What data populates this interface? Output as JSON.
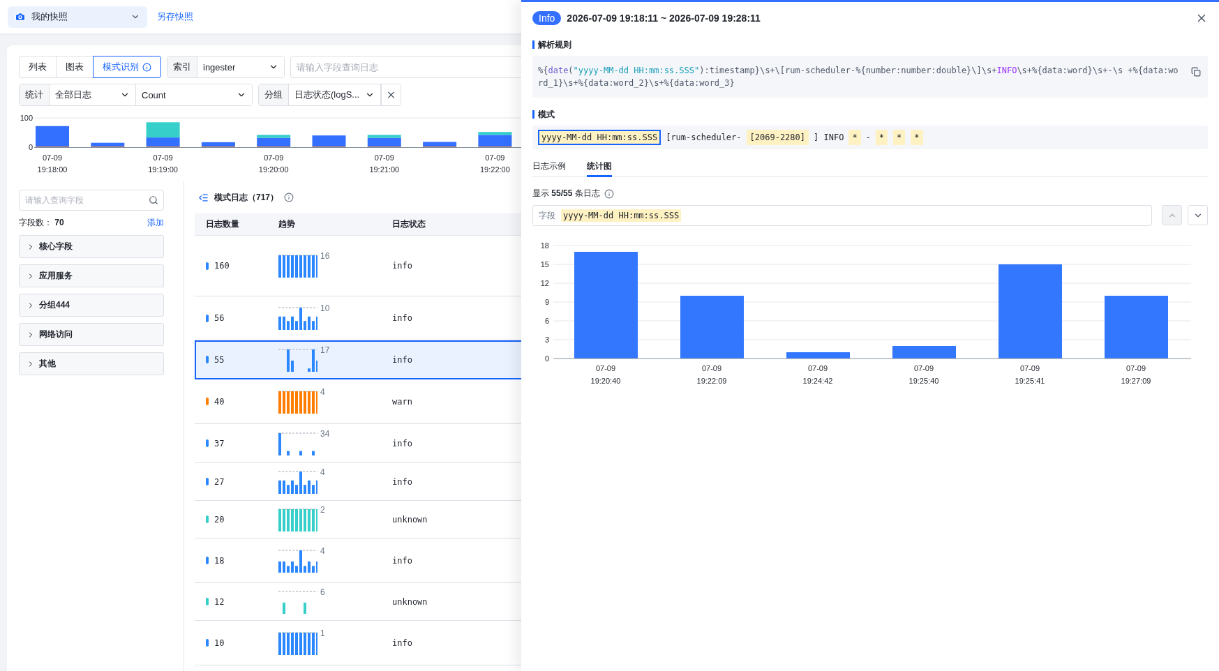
{
  "topbar": {
    "snapshot": "我的快照",
    "save_link": "另存快照"
  },
  "view_tabs": [
    {
      "label": "列表",
      "selected": false
    },
    {
      "label": "图表",
      "selected": false
    },
    {
      "label": "模式识别",
      "selected": true
    }
  ],
  "index_select": {
    "label": "索引",
    "value": "ingester"
  },
  "query_field": {
    "placeholder": "请输入字段查询日志"
  },
  "stat_select": {
    "label": "统计",
    "scope": "全部日志",
    "metric": "Count"
  },
  "group_select": {
    "label": "分组",
    "value": "日志状态(logS..."
  },
  "overview_chart": {
    "chart_data": {
      "type": "bar",
      "stacked": true,
      "categories": [
        "07-09 19:18:00",
        null,
        "07-09 19:19:00",
        null,
        "07-09 19:20:00",
        null,
        "07-09 19:21:00",
        null,
        "07-09 19:22:00"
      ],
      "yticks": [
        0,
        100
      ],
      "ylim": [
        0,
        100
      ],
      "series": [
        {
          "color": "#ff7d00",
          "values": [
            2,
            2,
            2,
            2,
            2,
            2,
            2,
            2,
            2
          ]
        },
        {
          "color": "#3370ff",
          "values": [
            70,
            13,
            31,
            15,
            30,
            38,
            30,
            16,
            40
          ]
        },
        {
          "color": "#36cfc9",
          "values": [
            0,
            0,
            52,
            0,
            10,
            0,
            10,
            0,
            10
          ]
        }
      ]
    }
  },
  "field_search": {
    "placeholder": "请输入查询字段"
  },
  "field_count": {
    "label": "字段数：",
    "value": "70",
    "add": "添加"
  },
  "field_groups": [
    {
      "label": "核心字段",
      "expanded": false
    },
    {
      "label": "应用服务",
      "expanded": false
    },
    {
      "label": "分组444",
      "expanded": false
    },
    {
      "label": "网络访问",
      "expanded": false
    },
    {
      "label": "其他",
      "expanded": false
    }
  ],
  "patterns": {
    "title": "模式日志（717）",
    "columns": [
      "日志数量",
      "趋势",
      "日志状态"
    ],
    "rows": [
      {
        "count": "160",
        "max": "16",
        "status": "info",
        "color": "#2b87ff",
        "selected": false
      },
      {
        "count": "56",
        "max": "10",
        "status": "info",
        "color": "#2b87ff",
        "selected": false
      },
      {
        "count": "55",
        "max": "17",
        "status": "info",
        "color": "#2b87ff",
        "selected": true
      },
      {
        "count": "40",
        "max": "4",
        "status": "warn",
        "color": "#ff7d00",
        "selected": false
      },
      {
        "count": "37",
        "max": "34",
        "status": "info",
        "color": "#2b87ff",
        "selected": false
      },
      {
        "count": "27",
        "max": "4",
        "status": "info",
        "color": "#2b87ff",
        "selected": false
      },
      {
        "count": "20",
        "max": "2",
        "status": "unknown",
        "color": "#36cfc9",
        "selected": false
      },
      {
        "count": "18",
        "max": "4",
        "status": "info",
        "color": "#2b87ff",
        "selected": false
      },
      {
        "count": "12",
        "max": "6",
        "status": "unknown",
        "color": "#36cfc9",
        "selected": false
      },
      {
        "count": "10",
        "max": "1",
        "status": "info",
        "color": "#2b87ff",
        "selected": false
      }
    ]
  },
  "drawer": {
    "badge": "Info",
    "title": "2026-07-09 19:18:11 ~ 2026-07-09 19:28:11",
    "rule_heading": "解析规则",
    "rule": [
      {
        "kind": "plain",
        "text": "%{"
      },
      {
        "kind": "func",
        "text": "date"
      },
      {
        "kind": "plain",
        "text": "("
      },
      {
        "kind": "string",
        "text": "\"yyyy-MM-dd HH:mm:ss.SSS\""
      },
      {
        "kind": "plain",
        "text": "):timestamp}\\s+\\[rum-scheduler-%{number:number:double}\\]\\s+"
      },
      {
        "kind": "keyword",
        "text": "INFO"
      },
      {
        "kind": "plain",
        "text": "\\s+%{data:word}\\s+-\\s +%{data:word_1}\\s+%{data:word_2}\\s+%{data:word_3}"
      }
    ],
    "pattern_heading": "模式",
    "pattern": [
      {
        "kind": "var",
        "text": "yyyy-MM-dd HH:mm:ss.SSS",
        "selected": true
      },
      {
        "kind": "plain",
        "text": "[rum-scheduler-",
        "selected": false
      },
      {
        "kind": "var",
        "text": "[2069-2280]",
        "selected": false
      },
      {
        "kind": "plain",
        "text": "] INFO",
        "selected": false
      },
      {
        "kind": "var",
        "text": "*",
        "selected": false
      },
      {
        "kind": "plain",
        "text": "-",
        "selected": false
      },
      {
        "kind": "var",
        "text": "*",
        "selected": false
      },
      {
        "kind": "var",
        "text": "*",
        "selected": false
      },
      {
        "kind": "var",
        "text": "*",
        "selected": false
      }
    ],
    "tabs": [
      {
        "label": "日志示例",
        "selected": false
      },
      {
        "label": "统计图",
        "selected": true
      }
    ],
    "summary": {
      "prefix": "显示",
      "value": "55/55",
      "suffix": "条日志"
    },
    "field": {
      "label": "字段",
      "value": "yyyy-MM-dd HH:mm:ss.SSS"
    },
    "prev_disabled": true,
    "chart_data": {
      "type": "bar",
      "categories": [
        "07-09 19:20:40",
        "07-09 19:22:09",
        "07-09 19:24:42",
        "07-09 19:25:40",
        "07-09 19:25:41",
        "07-09 19:27:09"
      ],
      "series": [
        {
          "color": "#3377ff",
          "values": [
            17,
            10,
            1,
            2,
            15,
            10
          ]
        }
      ],
      "ylim": [
        0,
        18
      ],
      "grid": true,
      "yticks": [
        0,
        3,
        6,
        9,
        12,
        15,
        18
      ]
    }
  }
}
